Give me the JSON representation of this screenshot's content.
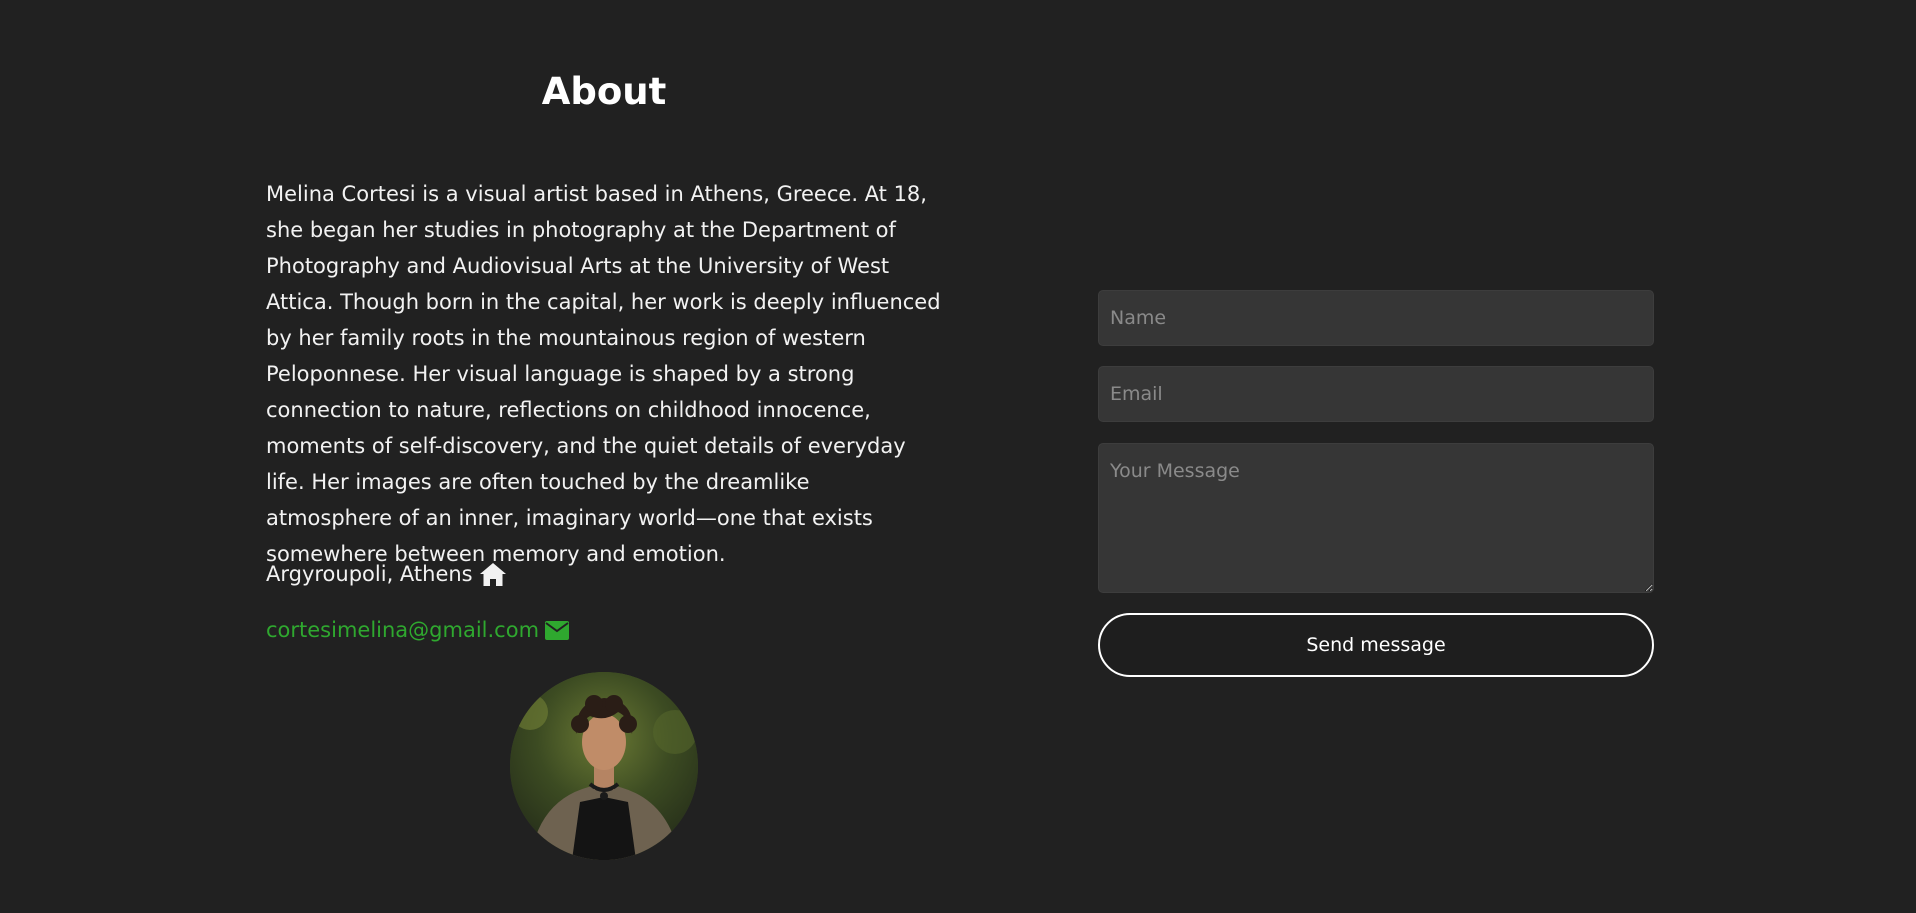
{
  "about": {
    "title": "About",
    "bio": "Melina Cortesi is a visual artist based in Athens, Greece. At 18, she began her studies in photography at the Department of Photography and Audiovisual Arts at the University of West Attica. Though born in the capital, her work is deeply influenced by her family roots in the mountainous region of western Peloponnese. Her visual language is shaped by a strong connection to nature, reflections on childhood innocence, moments of self-discovery, and the quiet details of everyday life. Her images are often touched by the dreamlike atmosphere of an inner, imaginary world—one that exists somewhere between memory and emotion.",
    "location": "Argyroupoli, Athens",
    "location_icon": "home-icon",
    "email": "cortesimelina@gmail.com",
    "email_icon": "envelope-icon",
    "email_color": "#2fa82f"
  },
  "contact_form": {
    "name_placeholder": "Name",
    "email_placeholder": "Email",
    "message_placeholder": "Your Message",
    "send_label": "Send message"
  },
  "colors": {
    "background": "#212121",
    "field_background": "#363636",
    "text": "#f2f2f2"
  }
}
